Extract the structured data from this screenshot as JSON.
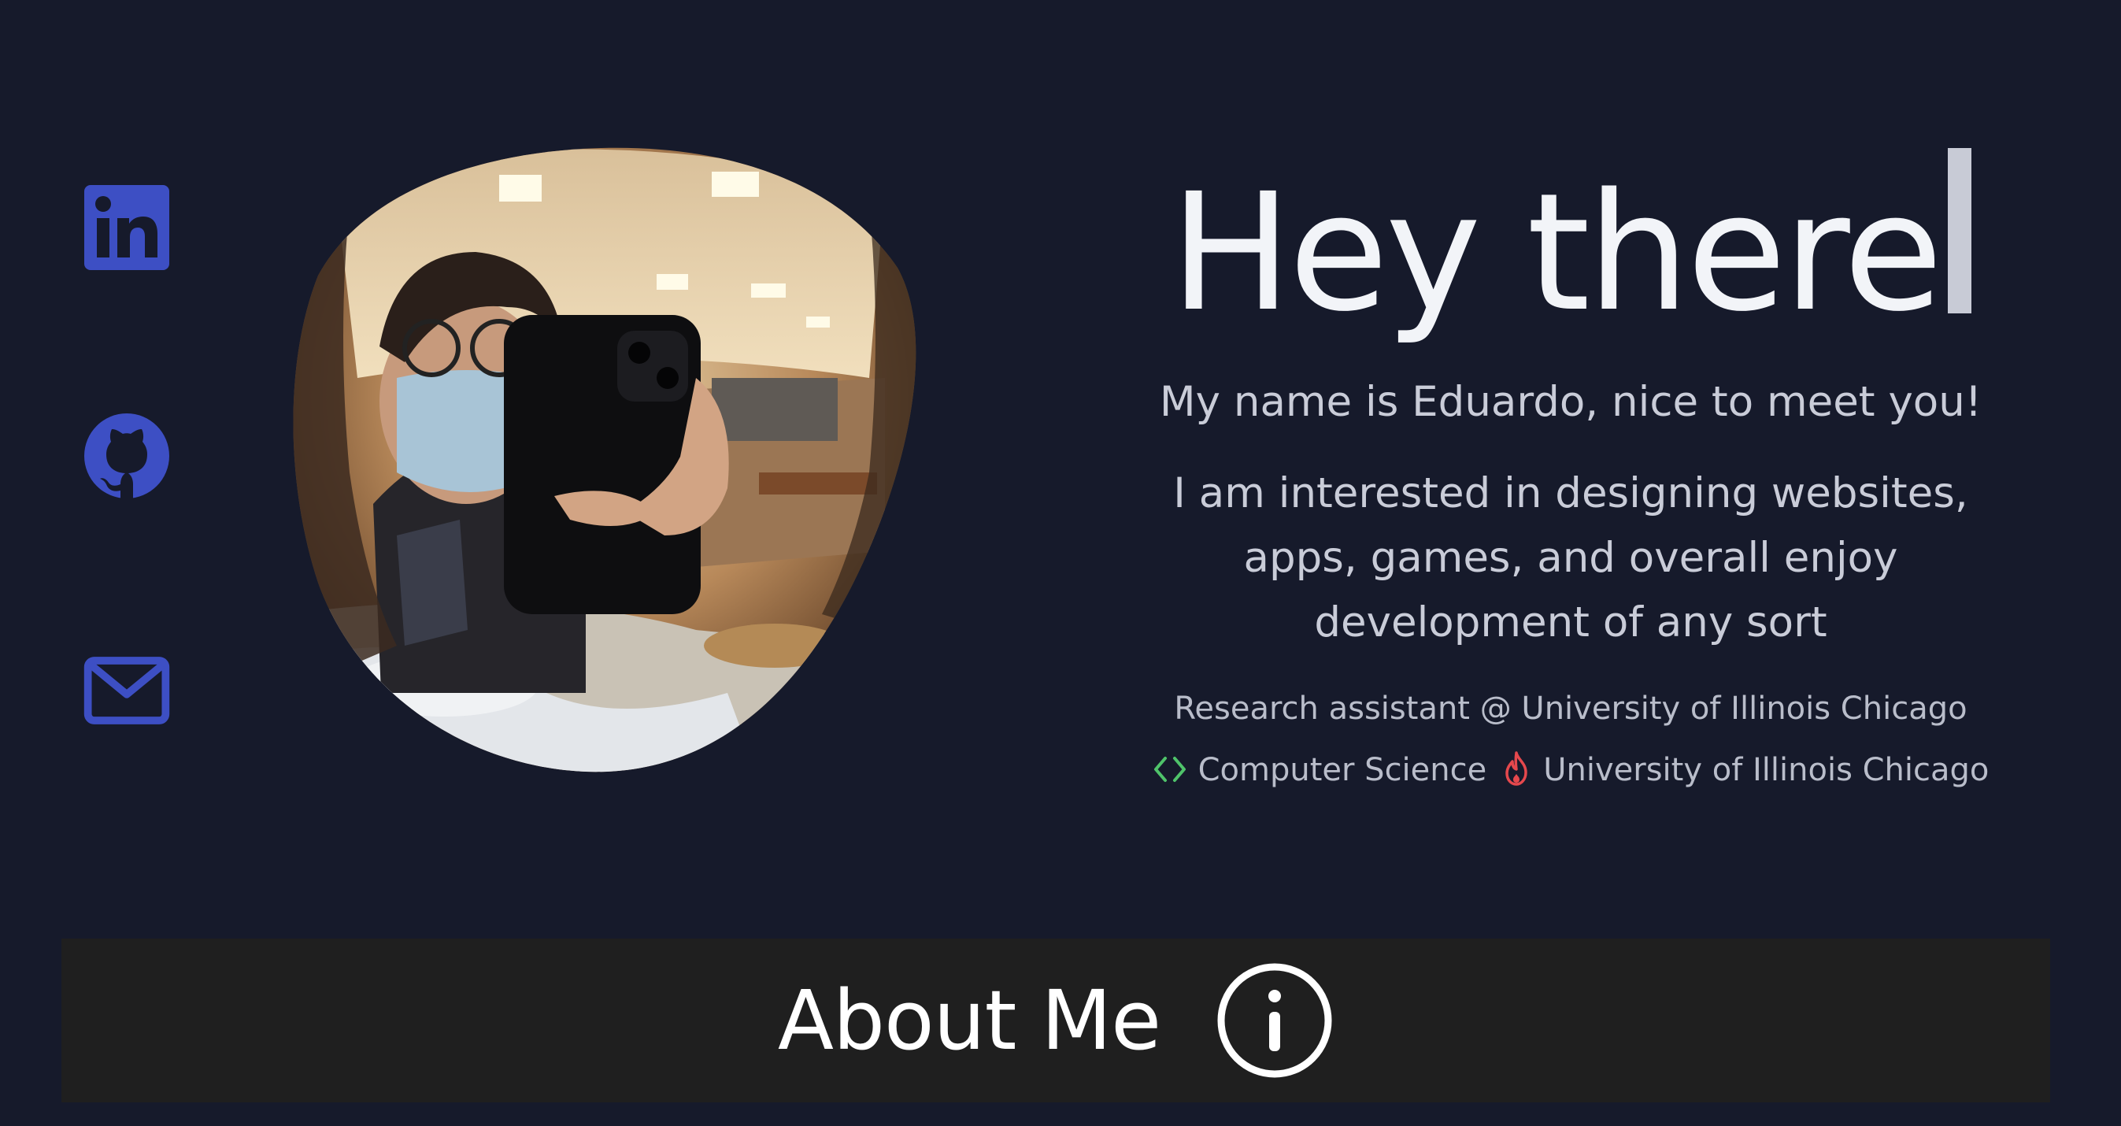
{
  "social": {
    "items": [
      {
        "id": "linkedin",
        "icon": "linkedin-icon",
        "color": "#3d4fc4"
      },
      {
        "id": "github",
        "icon": "github-icon",
        "color": "#3d4fc4"
      },
      {
        "id": "email",
        "icon": "mail-icon",
        "color": "#3d4fc4"
      }
    ]
  },
  "portrait": {
    "alt": "photo"
  },
  "hero": {
    "headline": "Hey there",
    "intro": "My name is Eduardo, nice to meet you!",
    "interest": "I am interested in designing websites, apps, games, and overall enjoy development of any sort",
    "research": "Research assistant @ University of Illinois Chicago",
    "major": "Computer Science",
    "school": "University of Illinois Chicago",
    "major_icon": "code-brackets-icon",
    "school_icon": "flame-icon",
    "major_icon_color": "#4fc36a",
    "school_icon_color": "#e5484d"
  },
  "about": {
    "label": "About Me",
    "icon": "info-icon"
  },
  "colors": {
    "background": "#161a2b",
    "accent": "#3d4fc4",
    "bar": "#1f1f1f"
  }
}
